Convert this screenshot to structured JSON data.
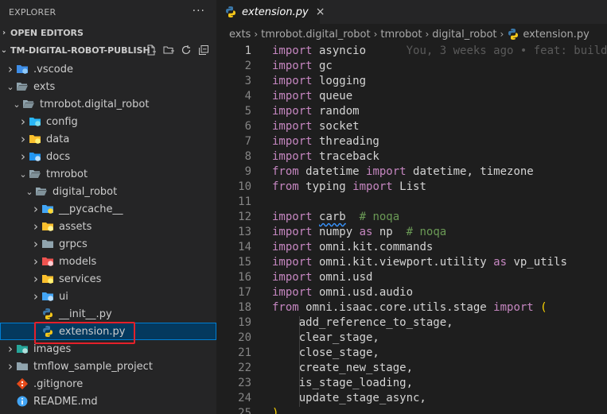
{
  "sidebar": {
    "title": "EXPLORER",
    "more": "···",
    "open_editors": "OPEN EDITORS",
    "project": "TM-DIGITAL-ROBOT-PUBLISH",
    "tree": [
      {
        "label": ".vscode",
        "depth": 0,
        "kind": "folder",
        "open": false,
        "icon": "vscode-folder-icon",
        "color": "#3e8ee8"
      },
      {
        "label": "exts",
        "depth": 0,
        "kind": "folder",
        "open": true,
        "icon": "folder-open-icon",
        "color": "#90a4ae"
      },
      {
        "label": "tmrobot.digital_robot",
        "depth": 1,
        "kind": "folder",
        "open": true,
        "icon": "folder-open-icon",
        "color": "#90a4ae"
      },
      {
        "label": "config",
        "depth": 2,
        "kind": "folder",
        "open": false,
        "icon": "config-folder-icon",
        "color": "#29b6f6"
      },
      {
        "label": "data",
        "depth": 2,
        "kind": "folder",
        "open": false,
        "icon": "data-folder-icon",
        "color": "#fbc02d"
      },
      {
        "label": "docs",
        "depth": 2,
        "kind": "folder",
        "open": false,
        "icon": "docs-folder-icon",
        "color": "#2196f3"
      },
      {
        "label": "tmrobot",
        "depth": 2,
        "kind": "folder",
        "open": true,
        "icon": "folder-open-icon",
        "color": "#90a4ae"
      },
      {
        "label": "digital_robot",
        "depth": 3,
        "kind": "folder",
        "open": true,
        "icon": "folder-open-icon",
        "color": "#90a4ae"
      },
      {
        "label": "__pycache__",
        "depth": 4,
        "kind": "folder",
        "open": false,
        "icon": "python-folder-icon",
        "color": "#42a5f5"
      },
      {
        "label": "assets",
        "depth": 4,
        "kind": "folder",
        "open": false,
        "icon": "assets-folder-icon",
        "color": "#fbc02d"
      },
      {
        "label": "grpcs",
        "depth": 4,
        "kind": "folder",
        "open": false,
        "icon": "folder-icon",
        "color": "#90a4ae"
      },
      {
        "label": "models",
        "depth": 4,
        "kind": "folder",
        "open": false,
        "icon": "models-folder-icon",
        "color": "#ef5350"
      },
      {
        "label": "services",
        "depth": 4,
        "kind": "folder",
        "open": false,
        "icon": "services-folder-icon",
        "color": "#fbc02d"
      },
      {
        "label": "ui",
        "depth": 4,
        "kind": "folder",
        "open": false,
        "icon": "ui-folder-icon",
        "color": "#42a5f5"
      },
      {
        "label": "__init__.py",
        "depth": 4,
        "kind": "file",
        "icon": "python-file-icon"
      },
      {
        "label": "extension.py",
        "depth": 4,
        "kind": "file",
        "icon": "python-file-icon",
        "selected": true
      },
      {
        "label": "images",
        "depth": 0,
        "kind": "folder",
        "open": false,
        "icon": "images-folder-icon",
        "color": "#26a69a"
      },
      {
        "label": "tmflow_sample_project",
        "depth": 0,
        "kind": "folder",
        "open": false,
        "icon": "folder-icon",
        "color": "#90a4ae"
      },
      {
        "label": ".gitignore",
        "depth": 0,
        "kind": "file",
        "icon": "git-file-icon"
      },
      {
        "label": "README.md",
        "depth": 0,
        "kind": "file",
        "icon": "info-file-icon"
      }
    ]
  },
  "tab": {
    "label": "extension.py",
    "close": "×"
  },
  "breadcrumb": [
    "exts",
    "tmrobot.digital_robot",
    "tmrobot",
    "digital_robot",
    "extension.py"
  ],
  "editor": {
    "blame": "You, 3 weeks ago • feat: build",
    "lines": [
      [
        [
          "kw",
          "import"
        ],
        [
          "t",
          " asyncio"
        ]
      ],
      [
        [
          "kw",
          "import"
        ],
        [
          "t",
          " gc"
        ]
      ],
      [
        [
          "kw",
          "import"
        ],
        [
          "t",
          " logging"
        ]
      ],
      [
        [
          "kw",
          "import"
        ],
        [
          "t",
          " queue"
        ]
      ],
      [
        [
          "kw",
          "import"
        ],
        [
          "t",
          " random"
        ]
      ],
      [
        [
          "kw",
          "import"
        ],
        [
          "t",
          " socket"
        ]
      ],
      [
        [
          "kw",
          "import"
        ],
        [
          "t",
          " threading"
        ]
      ],
      [
        [
          "kw",
          "import"
        ],
        [
          "t",
          " traceback"
        ]
      ],
      [
        [
          "kw",
          "from"
        ],
        [
          "t",
          " datetime "
        ],
        [
          "kw",
          "import"
        ],
        [
          "t",
          " datetime, timezone"
        ]
      ],
      [
        [
          "kw",
          "from"
        ],
        [
          "t",
          " typing "
        ],
        [
          "kw",
          "import"
        ],
        [
          "t",
          " List"
        ]
      ],
      [],
      [
        [
          "kw",
          "import"
        ],
        [
          "t",
          " "
        ],
        [
          "sq",
          "carb"
        ],
        [
          "t",
          "  "
        ],
        [
          "cm",
          "# noqa"
        ]
      ],
      [
        [
          "kw",
          "import"
        ],
        [
          "t",
          " numpy "
        ],
        [
          "kw",
          "as"
        ],
        [
          "t",
          " np  "
        ],
        [
          "cm",
          "# noqa"
        ]
      ],
      [
        [
          "kw",
          "import"
        ],
        [
          "t",
          " omni.kit.commands"
        ]
      ],
      [
        [
          "kw",
          "import"
        ],
        [
          "t",
          " omni.kit.viewport.utility "
        ],
        [
          "kw",
          "as"
        ],
        [
          "t",
          " vp_utils"
        ]
      ],
      [
        [
          "kw",
          "import"
        ],
        [
          "t",
          " omni.usd"
        ]
      ],
      [
        [
          "kw",
          "import"
        ],
        [
          "t",
          " omni.usd.audio"
        ]
      ],
      [
        [
          "kw",
          "from"
        ],
        [
          "t",
          " omni.isaac.core.utils.stage "
        ],
        [
          "kw",
          "import"
        ],
        [
          "t",
          " "
        ],
        [
          "pn",
          "("
        ]
      ],
      [
        [
          "t",
          "    add_reference_to_stage,"
        ]
      ],
      [
        [
          "t",
          "    clear_stage,"
        ]
      ],
      [
        [
          "t",
          "    close_stage,"
        ]
      ],
      [
        [
          "t",
          "    create_new_stage,"
        ]
      ],
      [
        [
          "t",
          "    is_stage_loading,"
        ]
      ],
      [
        [
          "t",
          "    update_stage_async,"
        ]
      ],
      [
        [
          "pn",
          ")"
        ]
      ]
    ]
  }
}
